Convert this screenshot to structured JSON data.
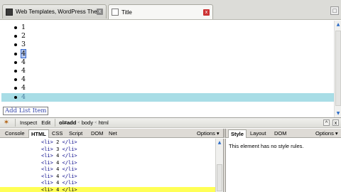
{
  "tabs": [
    {
      "title": "Web Templates, WordPress Themes - T...",
      "close": "x"
    },
    {
      "title": "Title",
      "close": "x"
    }
  ],
  "window": {
    "restore_icon": "□"
  },
  "page": {
    "list_items": [
      "1",
      "2",
      "3",
      "4",
      "4",
      "4",
      "4",
      "4",
      "4"
    ],
    "inspected_index": 3,
    "highlighted_index": 8,
    "add_button_label": "Add List Item"
  },
  "firebug": {
    "toolbar": {
      "bug_icon": "✶",
      "inspect_label": "Inspect",
      "edit_label": "Edit",
      "breadcrumbs": [
        "ol#add",
        "body",
        "html"
      ],
      "crumb_sep": "<",
      "minimize_icon": "^",
      "close_icon": "x"
    },
    "tabs": [
      "Console",
      "HTML",
      "CSS",
      "Script",
      "DOM",
      "Net"
    ],
    "active_tab": "HTML",
    "options_label": "Options ▾",
    "side_tabs": [
      "Style",
      "Layout",
      "DOM"
    ],
    "side_active_tab": "Style",
    "side_options_label": "Options ▾",
    "side_message": "This element has no style rules.",
    "html_lines": [
      {
        "open": "<li>",
        "value": "2",
        "close": "</li>"
      },
      {
        "open": "<li>",
        "value": "3",
        "close": "</li>"
      },
      {
        "open": "<li>",
        "value": "4",
        "close": "</li>"
      },
      {
        "open": "<li>",
        "value": "4",
        "close": "</li>"
      },
      {
        "open": "<li>",
        "value": "4",
        "close": "</li>"
      },
      {
        "open": "<li>",
        "value": "4",
        "close": "</li>"
      },
      {
        "open": "<li>",
        "value": "4",
        "close": "</li>"
      },
      {
        "open": "<li>",
        "value": "4",
        "close": "</li>"
      }
    ],
    "selected_line_index": 7
  },
  "colors": {
    "highlight_row": "#a8dde6",
    "firebug_selection": "#ffff55",
    "link_blue": "#3344aa"
  }
}
